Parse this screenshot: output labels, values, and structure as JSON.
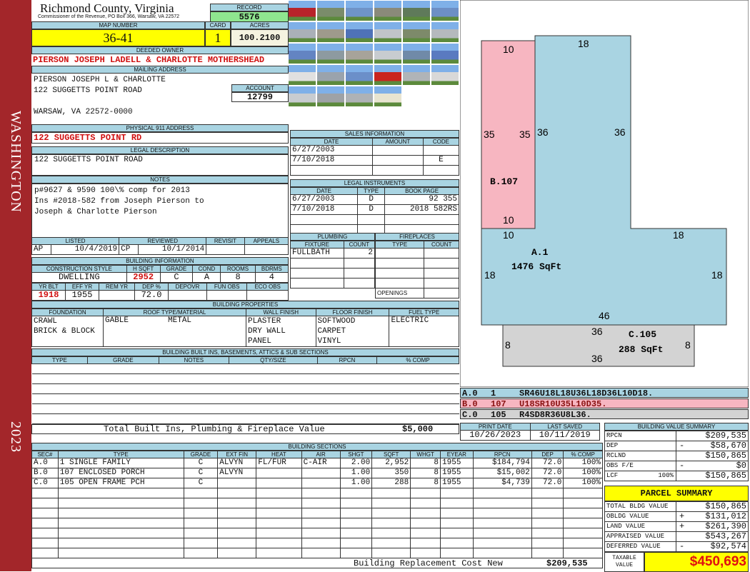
{
  "side": {
    "name": "WASHINGTON",
    "year": "2023"
  },
  "header": {
    "title": "Richmond County, Virginia",
    "subtitle": "Commissioner of the Revenue, PO Box 366, Warsaw, VA 22572",
    "record_label": "RECORD",
    "record": "5576"
  },
  "map": {
    "map_label": "MAP NUMBER",
    "map_number": "36-41",
    "card_label": "CARD",
    "card": "1",
    "acres_label": "ACRES",
    "acres": "100.2100"
  },
  "owner": {
    "label": "DEEDED OWNER",
    "value": "PIERSON JOSEPH LADELL & CHARLOTTE MOTHERSHEAD"
  },
  "mailing": {
    "label": "MAILING ADDRESS",
    "line1": "PIERSON JOSEPH L & CHARLOTTE",
    "line2": "122 SUGGETTS POINT ROAD",
    "line3": "WARSAW, VA 22572-0000",
    "account_label": "ACCOUNT",
    "account": "12799"
  },
  "physical": {
    "label": "PHYSICAL 911 ADDRESS",
    "value": "122 SUGGETTS POINT RD"
  },
  "legal": {
    "label": "LEGAL DESCRIPTION",
    "value": "122 SUGGETTS POINT ROAD"
  },
  "notes": {
    "label": "NOTES",
    "line1": "p#9627 & 9590 100\\% comp for 2013",
    "line2": "Ins #2018-582 from Joseph Pierson to",
    "line3": "Joseph & Charlotte Pierson"
  },
  "sales": {
    "label": "SALES INFORMATION",
    "cols": [
      "DATE",
      "AMOUNT",
      "CODE"
    ],
    "rows": [
      [
        "6/27/2003",
        "",
        ""
      ],
      [
        "7/10/2018",
        "",
        "E"
      ],
      [
        "",
        "",
        ""
      ]
    ]
  },
  "instruments": {
    "label": "LEGAL INSTRUMENTS",
    "cols": [
      "DATE",
      "TYPE",
      "BOOK PAGE"
    ],
    "rows": [
      [
        "6/27/2003",
        "D",
        "92 355"
      ],
      [
        "7/10/2018",
        "D",
        "2018 582RS"
      ],
      [
        "",
        "",
        ""
      ],
      [
        "",
        "",
        ""
      ]
    ]
  },
  "listed": {
    "cols": [
      "LISTED",
      "REVIEWED",
      "REVISIT",
      "APPEALS"
    ],
    "listed_by": "AP",
    "listed_date": "10/4/2019",
    "reviewed_by": "CP",
    "reviewed_date": "10/1/2014",
    "revisit": "",
    "appeals": ""
  },
  "building_info": {
    "label": "BUILDING INFORMATION",
    "cols1": [
      "CONSTRUCTION STYLE",
      "H SQFT",
      "GRADE",
      "COND",
      "ROOMS",
      "BDRMS"
    ],
    "vals1": [
      "DWELLING",
      "2952",
      "C",
      "A",
      "8",
      "4"
    ],
    "cols2": [
      "YR BLT",
      "EFF YR",
      "REM YR",
      "DEP %",
      "DEPOVR",
      "FUN OBS",
      "ECO OBS"
    ],
    "vals2": [
      "1918",
      "1955",
      "",
      "72.0",
      "",
      "",
      ""
    ]
  },
  "plumbing": {
    "label": "PLUMBING",
    "cols": [
      "FIXTURE",
      "COUNT"
    ],
    "rows": [
      [
        "FULLBATH",
        "2"
      ],
      [
        "",
        ""
      ],
      [
        "",
        ""
      ],
      [
        "",
        ""
      ]
    ]
  },
  "fireplaces": {
    "label": "FIREPLACES",
    "cols": [
      "TYPE",
      "COUNT"
    ],
    "openings_label": "OPENINGS"
  },
  "properties": {
    "label": "BUILDING PROPERTIES",
    "cols": [
      "FOUNDATION",
      "ROOF TYPE/MATERIAL",
      "WALL FINISH",
      "FLOOR FINISH",
      "FUEL TYPE"
    ],
    "foundation": [
      "CRAWL",
      "BRICK & BLOCK"
    ],
    "roof_type": "GABLE",
    "roof_material": "METAL",
    "wall": [
      "PLASTER",
      "DRY WALL",
      "PANEL"
    ],
    "floor": [
      "SOFTWOOD",
      "CARPET",
      "VINYL"
    ],
    "fuel": [
      "ELECTRIC"
    ]
  },
  "builtins": {
    "label": "BUILDING BUILT INS, BASEMENTS, ATTICS & SUB SECTIONS",
    "cols": [
      "TYPE",
      "GRADE",
      "NOTES",
      "QTY/SIZE",
      "RPCN",
      "% COMP"
    ],
    "total_label": "Total Built Ins, Plumbing & Fireplace Value",
    "total": "$5,000"
  },
  "sections": {
    "label": "BUILDING SECTIONS",
    "cols": [
      "SEC#",
      "TYPE",
      "GRADE",
      "EXT FIN",
      "HEAT",
      "AIR",
      "SHGT",
      "SQFT",
      "WHGT",
      "EYEAR",
      "RPCN",
      "DEP",
      "% COMP"
    ],
    "rows": [
      [
        "A.0",
        "1 SINGLE FAMILY",
        "C",
        "ALVYN",
        "FL/FUR",
        "C-AIR",
        "2.00",
        "2,952",
        "8",
        "1955",
        "$184,794",
        "72.0",
        "100%"
      ],
      [
        "B.0",
        "107 ENCLOSED PORCH",
        "C",
        "ALVYN",
        "",
        "",
        "1.00",
        "350",
        "8",
        "1955",
        "$15,002",
        "72.0",
        "100%"
      ],
      [
        "C.0",
        "105 OPEN FRAME PCH",
        "C",
        "",
        "",
        "",
        "1.00",
        "288",
        "8",
        "1955",
        "$4,739",
        "72.0",
        "100%"
      ]
    ],
    "total_label": "Building Replacement Cost New",
    "total": "$209,535"
  },
  "sketch": {
    "a_label": "A.1",
    "a_area": "1476 SqFt",
    "b_label": "B.107",
    "c_label": "C.105",
    "c_area": "288 SqFt",
    "dims": {
      "a_top": "18",
      "a_left_upper": "36",
      "a_right_upper": "36",
      "a_mid_left": "10",
      "a_mid_right": "18",
      "a_side_left": "18",
      "a_side_right": "18",
      "a_bottom": "46",
      "b_top": "10",
      "b_left": "35",
      "b_right": "35",
      "b_bottom": "10",
      "c_top": "36",
      "c_bottom": "36",
      "c_left": "8",
      "c_right": "8"
    },
    "colors": {
      "a": "#a9d4e2",
      "b": "#f7b6c1",
      "c": "#d3d3d3"
    },
    "lines": [
      {
        "sec": "A.0",
        "code": "1",
        "vector": "SR46U18L18U36L18D36L10D18."
      },
      {
        "sec": "B.0",
        "code": "107",
        "vector": "U18SR10U35L10D35."
      },
      {
        "sec": "C.0",
        "code": "105",
        "vector": "R4SD8R36U8L36."
      }
    ]
  },
  "dates": {
    "print_label": "PRINT DATE",
    "print": "10/26/2023",
    "saved_label": "LAST SAVED",
    "saved": "10/11/2019"
  },
  "bvs": {
    "label": "BUILDING VALUE SUMMARY",
    "rows": [
      {
        "k": "RPCN",
        "s": "",
        "v": "$209,535"
      },
      {
        "k": "DEP",
        "s": "-",
        "v": "$58,670"
      },
      {
        "k": "RCLND",
        "s": "",
        "v": "$150,865"
      },
      {
        "k": "OBS F/E",
        "s": "-",
        "v": "$0"
      },
      {
        "k": "LCF",
        "p": "100%",
        "s": "",
        "v": "$150,865"
      }
    ]
  },
  "parcel": {
    "label": "PARCEL SUMMARY",
    "rows": [
      {
        "k": "TOTAL BLDG VALUE",
        "s": "",
        "v": "$150,865"
      },
      {
        "k": "OBLDG VALUE",
        "s": "+",
        "v": "$131,012"
      },
      {
        "k": "LAND VALUE",
        "s": "+",
        "v": "$261,390"
      },
      {
        "k": "APPRAISED VALUE",
        "s": "",
        "v": "$543,267"
      },
      {
        "k": "DEFERRED VALUE",
        "s": "-",
        "v": "$92,574"
      }
    ],
    "taxable_label": "TAXABLE VALUE",
    "taxable": "$450,693"
  }
}
